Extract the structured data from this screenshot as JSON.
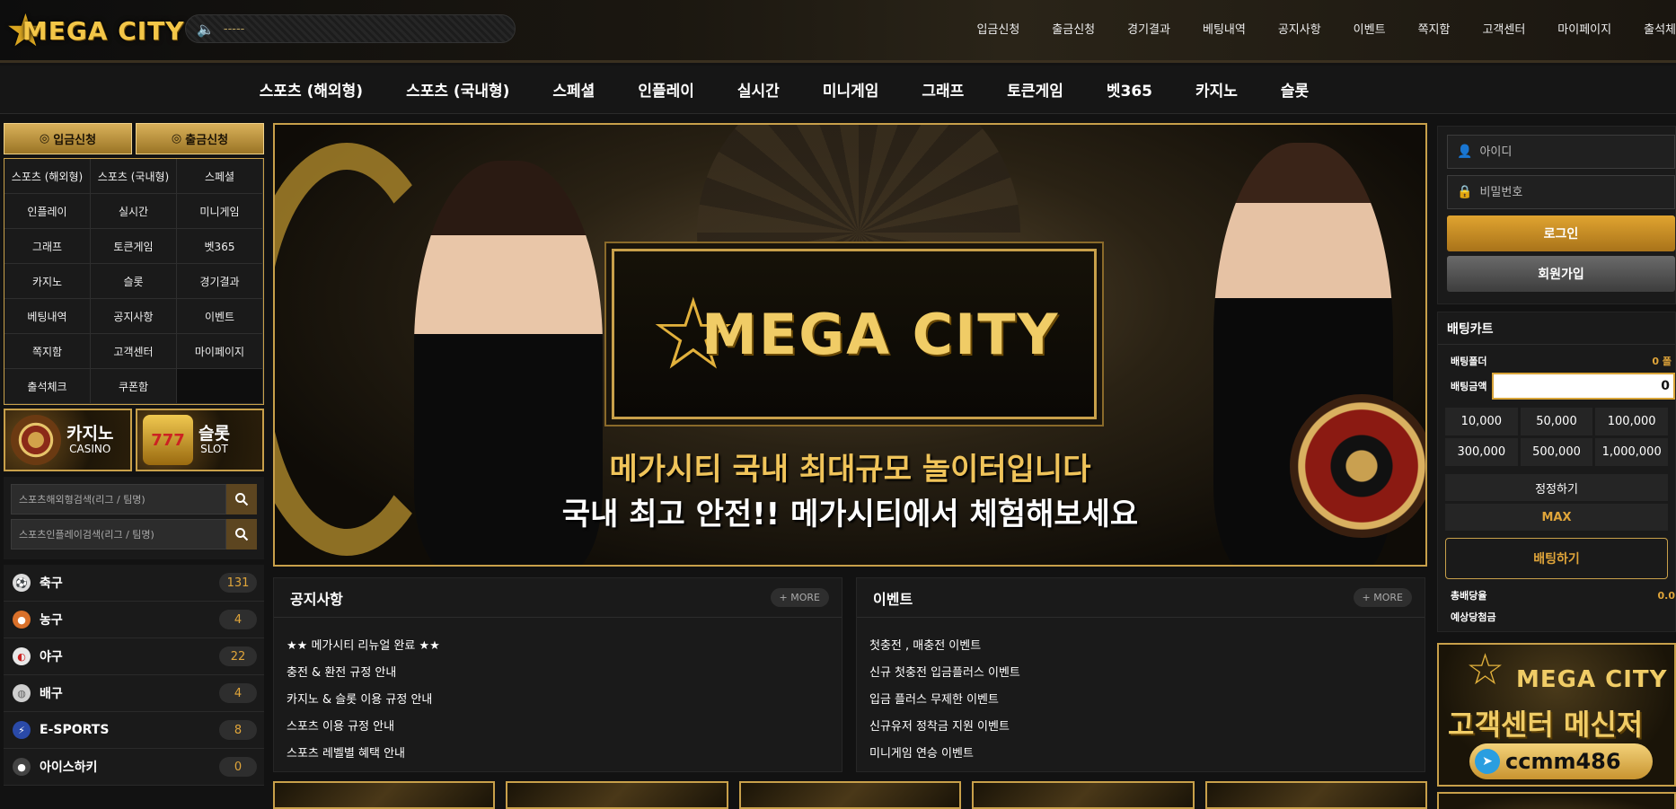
{
  "header": {
    "logo_text": "MEGA CITY",
    "marquee_text": "-----",
    "nav": [
      "입금신청",
      "출금신청",
      "경기결과",
      "베팅내역",
      "공지사항",
      "이벤트",
      "쪽지함",
      "고객센터",
      "마이페이지",
      "출석체"
    ]
  },
  "main_nav": [
    "스포츠 (해외형)",
    "스포츠 (국내형)",
    "스페셜",
    "인플레이",
    "실시간",
    "미니게임",
    "그래프",
    "토큰게임",
    "벳365",
    "카지노",
    "슬롯"
  ],
  "sidebar": {
    "deposit_label": "입금신청",
    "withdraw_label": "출금신청",
    "menu": [
      "스포츠 (해외형)",
      "스포츠 (국내형)",
      "스페셜",
      "인플레이",
      "실시간",
      "미니게임",
      "그래프",
      "토큰게임",
      "벳365",
      "카지노",
      "슬롯",
      "경기결과",
      "베팅내역",
      "공지사항",
      "이벤트",
      "쪽지함",
      "고객센터",
      "마이페이지",
      "출석체크",
      "쿠폰함"
    ],
    "casino": {
      "ko": "카지노",
      "en": "CASINO"
    },
    "slot": {
      "ko": "슬롯",
      "en": "SLOT"
    },
    "search_overseas_placeholder": "스포츠해외형검색(리그 / 팀명)",
    "search_inplay_placeholder": "스포츠인플레이검색(리그 / 팀명)",
    "sports": [
      {
        "name": "축구",
        "count": "131",
        "icon": "soccer-ball-icon",
        "color": "#dcdcdc"
      },
      {
        "name": "농구",
        "count": "4",
        "icon": "basketball-icon",
        "color": "#d9702a"
      },
      {
        "name": "야구",
        "count": "22",
        "icon": "baseball-icon",
        "color": "#e8e8e8"
      },
      {
        "name": "배구",
        "count": "4",
        "icon": "volleyball-icon",
        "color": "#cfcfcf"
      },
      {
        "name": "E-SPORTS",
        "count": "8",
        "icon": "esports-icon",
        "color": "#2a4aa8"
      },
      {
        "name": "아이스하키",
        "count": "0",
        "icon": "hockey-puck-icon",
        "color": "#444444"
      }
    ]
  },
  "banner": {
    "logo_text": "MEGA CITY",
    "headline": "메가시티 국내 최대규모 놀이터입니다",
    "subline": "국내 최고 안전!! 메가시티에서 체험해보세요"
  },
  "notice": {
    "title": "공지사항",
    "more": "+ MORE",
    "items": [
      "★★ 메가시티 리뉴얼 완료 ★★",
      "충전 & 환전 규정 안내",
      "카지노 & 슬롯 이용 규정 안내",
      "스포츠 이용 규정 안내",
      "스포츠 레벨별 혜택 안내"
    ]
  },
  "event": {
    "title": "이벤트",
    "more": "+ MORE",
    "items": [
      "첫충전 , 매충전 이벤트",
      "신규 첫충전 입금플러스 이벤트",
      "입금 플러스 무제한 이벤트",
      "신규유저 정착금 지원 이벤트",
      "미니게임 연승 이벤트"
    ]
  },
  "login": {
    "id_placeholder": "아이디",
    "pw_placeholder": "비밀번호",
    "login_button": "로그인",
    "signup_button": "회원가입"
  },
  "cart": {
    "title": "배팅카트",
    "folder_label": "배팅폴더",
    "folder_value": "0 폴",
    "amount_label": "배팅금액",
    "amount_value": "0",
    "chips": [
      "10,000",
      "50,000",
      "100,000",
      "300,000",
      "500,000",
      "1,000,000"
    ],
    "reset_label": "정정하기",
    "max_label": "MAX",
    "bet_button": "배팅하기",
    "total_odds_label": "총배당율",
    "total_odds_value": "0.0",
    "expected_label": "예상당첨금",
    "expected_value": ""
  },
  "cs_banner": {
    "logo_text": "MEGA CITY",
    "title": "고객센터 메신저",
    "telegram_id": "ccmm486"
  },
  "colors": {
    "accent_gold": "#c8a04a",
    "count_orange": "#e0a53a"
  }
}
